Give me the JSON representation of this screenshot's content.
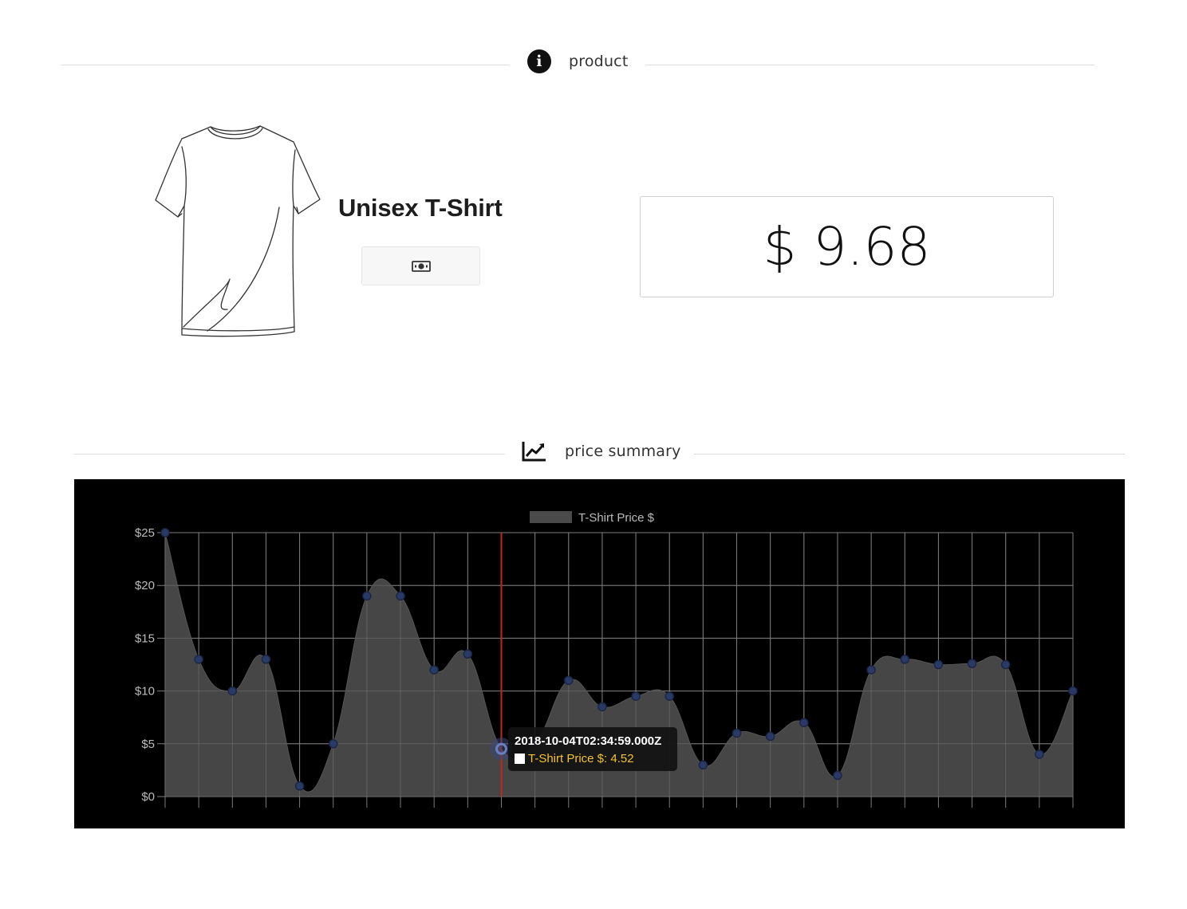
{
  "product_section": {
    "title": "product",
    "icon": "info-icon",
    "name": "Unisex T-Shirt",
    "price": "$ 9.68",
    "image_icon": "tshirt-icon",
    "button_icon": "money-icon"
  },
  "price_section": {
    "title": "price summary",
    "icon": "line-chart-icon"
  },
  "tooltip": {
    "title": "2018-10-04T02:34:59.000Z",
    "label": "T-Shirt Price $: 4.52"
  },
  "chart_data": {
    "type": "area",
    "legend": [
      "T-Shirt Price $"
    ],
    "series": [
      {
        "name": "T-Shirt Price $",
        "values": [
          25,
          13,
          10,
          13,
          1,
          5,
          19,
          19,
          12,
          13.5,
          4.52,
          5,
          11,
          8.5,
          9.5,
          9.5,
          3,
          6,
          5.7,
          7,
          2,
          12,
          13,
          12.5,
          12.6,
          12.5,
          4,
          10
        ]
      }
    ],
    "ylim": [
      0,
      25
    ],
    "y_ticks": [
      "$0",
      "$5",
      "$10",
      "$15",
      "$20",
      "$25"
    ],
    "grid": true,
    "highlight_index": 10,
    "colors": {
      "background": "#000000",
      "fill": "#4a4a4a",
      "grid": "#7a7a7a",
      "point": "#2a3a66",
      "cursor": "#c0281f",
      "tick_text": "#bbbbbb"
    }
  }
}
